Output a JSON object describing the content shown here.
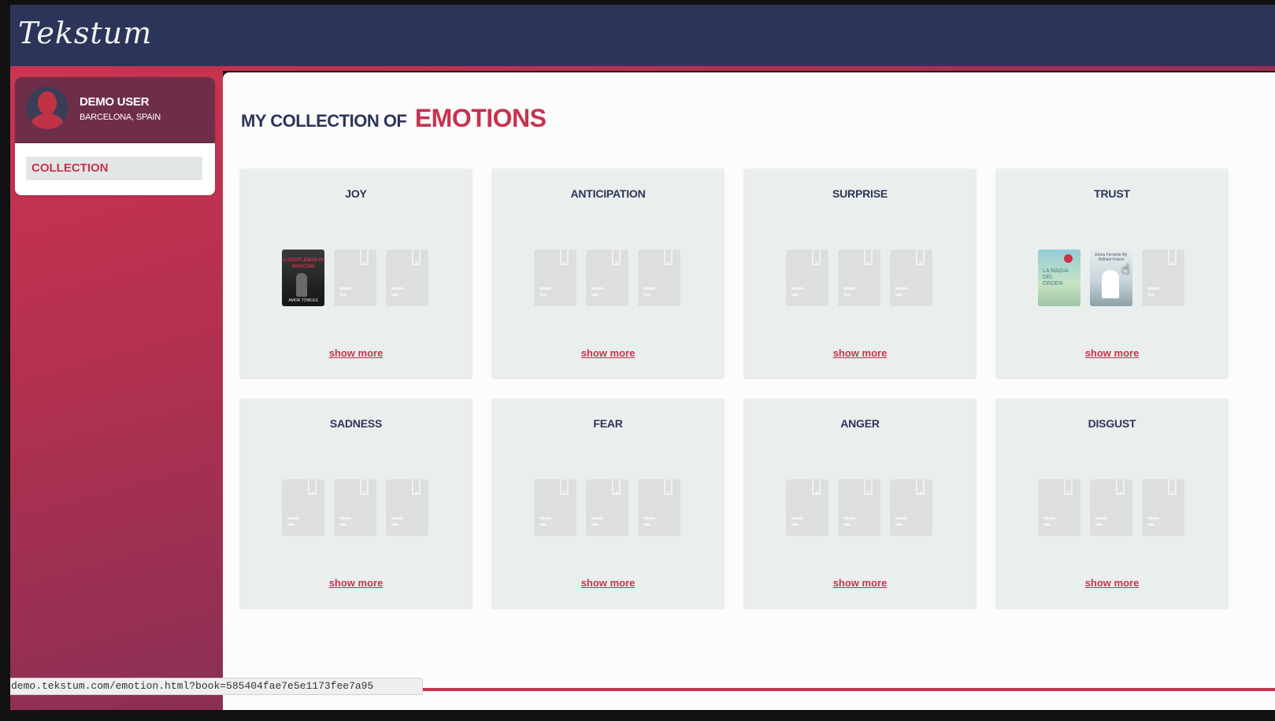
{
  "app": {
    "logo": "Tekstum"
  },
  "user": {
    "name": "DEMO USER",
    "location": "BARCELONA, SPAIN"
  },
  "sidebar": {
    "items": [
      {
        "label": "COLLECTION"
      }
    ]
  },
  "page": {
    "title_prefix": "MY COLLECTION OF",
    "title_emphasis": "EMOTIONS"
  },
  "emotions": [
    {
      "title": "JOY",
      "show_more": "show more",
      "books": [
        {
          "type": "cover",
          "cover_text": "A GENTLEMAN IN MOSCOW",
          "author": "AMOR TOWLES"
        },
        {
          "type": "placeholder"
        },
        {
          "type": "placeholder"
        }
      ]
    },
    {
      "title": "ANTICIPATION",
      "show_more": "show more",
      "books": [
        {
          "type": "placeholder"
        },
        {
          "type": "placeholder"
        },
        {
          "type": "placeholder"
        }
      ]
    },
    {
      "title": "SURPRISE",
      "show_more": "show more",
      "books": [
        {
          "type": "placeholder"
        },
        {
          "type": "placeholder"
        },
        {
          "type": "placeholder"
        }
      ]
    },
    {
      "title": "TRUST",
      "show_more": "show more",
      "books": [
        {
          "type": "cover",
          "cover_text": "LA MAGIA DEL ORDEN"
        },
        {
          "type": "cover",
          "cover_text": "Elena Ferrante My Brilliant Friend"
        },
        {
          "type": "placeholder"
        }
      ]
    },
    {
      "title": "SADNESS",
      "show_more": "show more",
      "books": [
        {
          "type": "placeholder"
        },
        {
          "type": "placeholder"
        },
        {
          "type": "placeholder"
        }
      ]
    },
    {
      "title": "FEAR",
      "show_more": "show more",
      "books": [
        {
          "type": "placeholder"
        },
        {
          "type": "placeholder"
        },
        {
          "type": "placeholder"
        }
      ]
    },
    {
      "title": "ANGER",
      "show_more": "show more",
      "books": [
        {
          "type": "placeholder"
        },
        {
          "type": "placeholder"
        },
        {
          "type": "placeholder"
        }
      ]
    },
    {
      "title": "DISGUST",
      "show_more": "show more",
      "books": [
        {
          "type": "placeholder"
        },
        {
          "type": "placeholder"
        },
        {
          "type": "placeholder"
        }
      ]
    }
  ],
  "status_bar": {
    "url": "demo.tekstum.com/emotion.html?book=585404fae7e5e1173fee7a95"
  },
  "icons": {
    "avatar": "user-avatar-icon",
    "placeholder": "bookmark-book-icon",
    "cursor": "hand-pointer-icon"
  },
  "colors": {
    "navy": "#2c3559",
    "crimson": "#c8324f",
    "card": "#eaeeed",
    "background": "#fbfcfb"
  }
}
